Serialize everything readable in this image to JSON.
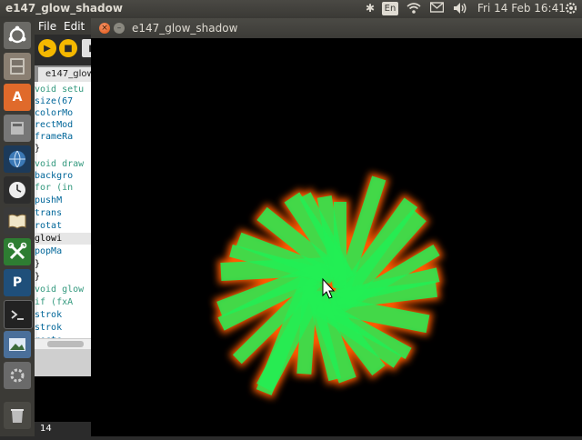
{
  "topbar": {
    "app_title": "e147_glow_shadow",
    "keyboard_layout": "En",
    "datetime": "Fri 14 Feb  16:41"
  },
  "ide": {
    "menu": [
      "File",
      "Edit"
    ],
    "tab_label": "e147_glow",
    "code_lines": [
      "void setu",
      "  size(67",
      "  colorMo",
      "  rectMod",
      "  frameRa",
      "}",
      "void draw",
      "  backgro",
      "  for (in",
      "    pushM",
      "    trans",
      "    rotat",
      "    glowi",
      "    popMa",
      "  }",
      "}",
      "void glow",
      "  if (fxA",
      "    strok",
      "    strok",
      "    recte"
    ],
    "status_line": "14"
  },
  "sketch_window": {
    "title": "e147_glow_shadow"
  },
  "colors": {
    "glow_fill": "#22ee55",
    "glow_shadow": "#ff5a00",
    "background": "#000000"
  }
}
